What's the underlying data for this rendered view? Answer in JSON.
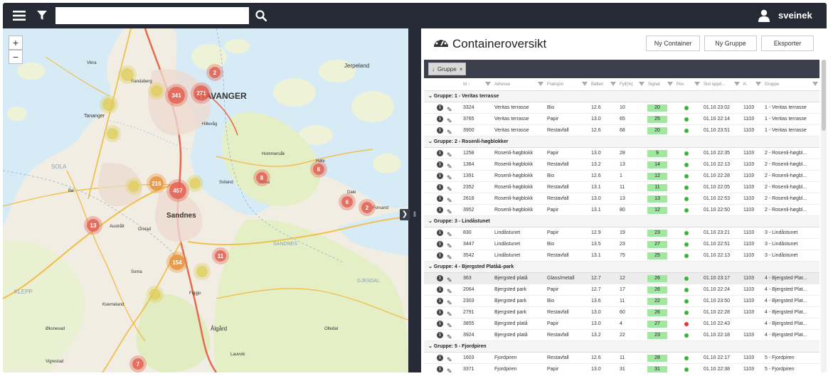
{
  "topbar": {
    "search_placeholder": "",
    "username": "sveinek"
  },
  "map": {
    "zoom_in": "+",
    "zoom_out": "−",
    "places": [
      "STAVANGER",
      "Sandnes",
      "SOLA",
      "KLEPP",
      "Jerpeland",
      "Tananger",
      "Ålgård",
      "SANDNES",
      "Forsand",
      "GJESDAL",
      "Vikra",
      "Randaberg",
      "Hillevåg",
      "Dale",
      "Hommersåk",
      "Bø",
      "Høle",
      "Figgjo",
      "Orstad",
      "Kverneland",
      "Øksnevad",
      "Soma",
      "Vigrestad",
      "Lauvvik",
      "Oltedal",
      "Riska",
      "Austrått",
      "Sviland"
    ],
    "clusters": [
      {
        "label": "341",
        "color": "red"
      },
      {
        "label": "271",
        "color": "red"
      },
      {
        "label": "2",
        "color": "red"
      },
      {
        "label": "216",
        "color": "orange"
      },
      {
        "label": "457",
        "color": "red"
      },
      {
        "label": "8",
        "color": "red"
      },
      {
        "label": "6",
        "color": "red"
      },
      {
        "label": "6",
        "color": "red"
      },
      {
        "label": "2",
        "color": "red"
      },
      {
        "label": "13",
        "color": "red"
      },
      {
        "label": "11",
        "color": "red"
      },
      {
        "label": "154",
        "color": "orange"
      },
      {
        "label": "7",
        "color": "red"
      },
      {
        "label": "",
        "color": "yellow"
      },
      {
        "label": "",
        "color": "yellow"
      },
      {
        "label": "",
        "color": "yellow"
      },
      {
        "label": "",
        "color": "yellow"
      },
      {
        "label": "",
        "color": "yellow"
      },
      {
        "label": "",
        "color": "yellow"
      },
      {
        "label": "",
        "color": "yellow"
      },
      {
        "label": "",
        "color": "yellow"
      }
    ]
  },
  "panel": {
    "title": "Containeroversikt",
    "buttons": {
      "new_container": "Ny Container",
      "new_group": "Ny Gruppe",
      "export": "Eksporter"
    },
    "group_chip": "Gruppe",
    "group_chip_close": "×",
    "columns": [
      "Id ↑",
      "Adresse",
      "Fraksjon",
      "Batteri",
      "Fyll(%)",
      "Signal",
      "Pos",
      "Sist oppd...",
      "K.",
      "Gruppe"
    ],
    "groups": [
      {
        "label": "Gruppe: 1 - Veritas terrasse",
        "rows": [
          [
            "3324",
            "Veritas terrasse",
            "Bio",
            "12.6",
            "10",
            "20",
            "green",
            "01.10 23:02",
            "1103",
            "1 - Veritas terrasse"
          ],
          [
            "3765",
            "Veritas terrasse",
            "Papir",
            "13.0",
            "65",
            "25",
            "green",
            "01.10 22:14",
            "1103",
            "1 - Veritas terrasse"
          ],
          [
            "3900",
            "Veritas terrasse",
            "Restavfall",
            "12.6",
            "68",
            "20",
            "green",
            "01.10 23:51",
            "1103",
            "1 - Veritas terrasse"
          ]
        ]
      },
      {
        "label": "Gruppe: 2 - Rosenli-høgblokker",
        "rows": [
          [
            "1258",
            "Rosenli-høgblokk",
            "Papir",
            "13.0",
            "28",
            "9",
            "green",
            "01.10 22:35",
            "1103",
            "2 - Rosenli-høgbl..."
          ],
          [
            "1384",
            "Rosenli-høgblokk",
            "Restavfall",
            "13.2",
            "13",
            "14",
            "green",
            "01.10 22:13",
            "1103",
            "2 - Rosenli-høgbl..."
          ],
          [
            "1391",
            "Rosenli-høgblokk",
            "Bio",
            "12.6",
            "1",
            "12",
            "green",
            "01.10 22:28",
            "1103",
            "2 - Rosenli-høgbl..."
          ],
          [
            "2352",
            "Rosenli-høgblokk",
            "Restavfall",
            "13.1",
            "11",
            "11",
            "green",
            "01.10 22:05",
            "1103",
            "2 - Rosenli-høgbl..."
          ],
          [
            "2618",
            "Rosenli-høgblokk",
            "Restavfall",
            "13.0",
            "13",
            "13",
            "green",
            "01.10 22:53",
            "1103",
            "2 - Rosenli-høgbl..."
          ],
          [
            "3952",
            "Rosenli-høgblokk",
            "Papir",
            "13.1",
            "80",
            "12",
            "green",
            "01.10 22:50",
            "1103",
            "2 - Rosenli-høgbl..."
          ]
        ]
      },
      {
        "label": "Gruppe: 3 - Lindåstunet",
        "rows": [
          [
            "830",
            "Lindåstunet",
            "Papir",
            "12.9",
            "19",
            "23",
            "green",
            "01.10 23:21",
            "1103",
            "3 - Lindåstunet"
          ],
          [
            "3447",
            "Lindåstunet",
            "Bio",
            "13.5",
            "23",
            "27",
            "green",
            "01.10 22:51",
            "1103",
            "3 - Lindåstunet"
          ],
          [
            "3542",
            "Lindåstunet",
            "Restavfall",
            "13.1",
            "75",
            "25",
            "green",
            "01.10 22:13",
            "1103",
            "3 - Lindåstunet"
          ]
        ]
      },
      {
        "label": "Gruppe: 4 - Bjergsted Platå&-park",
        "rows": [
          [
            "363",
            "Bjergsted platå",
            "Glass/metall",
            "12.7",
            "12",
            "26",
            "green",
            "01.10 23:17",
            "1103",
            "4 - Bjergsted Plat..."
          ],
          [
            "2064",
            "Bjergsted park",
            "Papir",
            "12.7",
            "17",
            "26",
            "green",
            "01.10 22:24",
            "1103",
            "4 - Bjergsted Plat..."
          ],
          [
            "2303",
            "Bjergsted park",
            "Bio",
            "13.6",
            "11",
            "22",
            "green",
            "01.10 23:50",
            "1103",
            "4 - Bjergsted Plat..."
          ],
          [
            "2791",
            "Bjergsted park",
            "Restavfall",
            "13.0",
            "60",
            "26",
            "green",
            "01.10 22:28",
            "1103",
            "4 - Bjergsted Plat..."
          ],
          [
            "3855",
            "Bjergsted platå",
            "Papir",
            "13.0",
            "4",
            "27",
            "red",
            "01.10 22:43",
            "",
            "4 - Bjergsted Plat..."
          ],
          [
            "3924",
            "Bjergsted platå",
            "Restavfall",
            "13.2",
            "22",
            "23",
            "green",
            "01.10 22:18",
            "1103",
            "4 - Bjergsted Plat..."
          ]
        ]
      },
      {
        "label": "Gruppe: 5 - Fjordpiren",
        "rows": [
          [
            "1603",
            "Fjordpiren",
            "Restavfall",
            "12.6",
            "11",
            "28",
            "green",
            "01.10 22:17",
            "1103",
            "5 - Fjordpiren"
          ],
          [
            "3371",
            "Fjordpiren",
            "Papir",
            "13.0",
            "31",
            "31",
            "green",
            "01.10 22:38",
            "1103",
            "5 - Fjordpiren"
          ]
        ]
      }
    ]
  },
  "colors": {
    "topbar": "#262a35",
    "signal": "#9fe89f",
    "pos_ok": "#39b53a",
    "pos_err": "#e53935"
  }
}
